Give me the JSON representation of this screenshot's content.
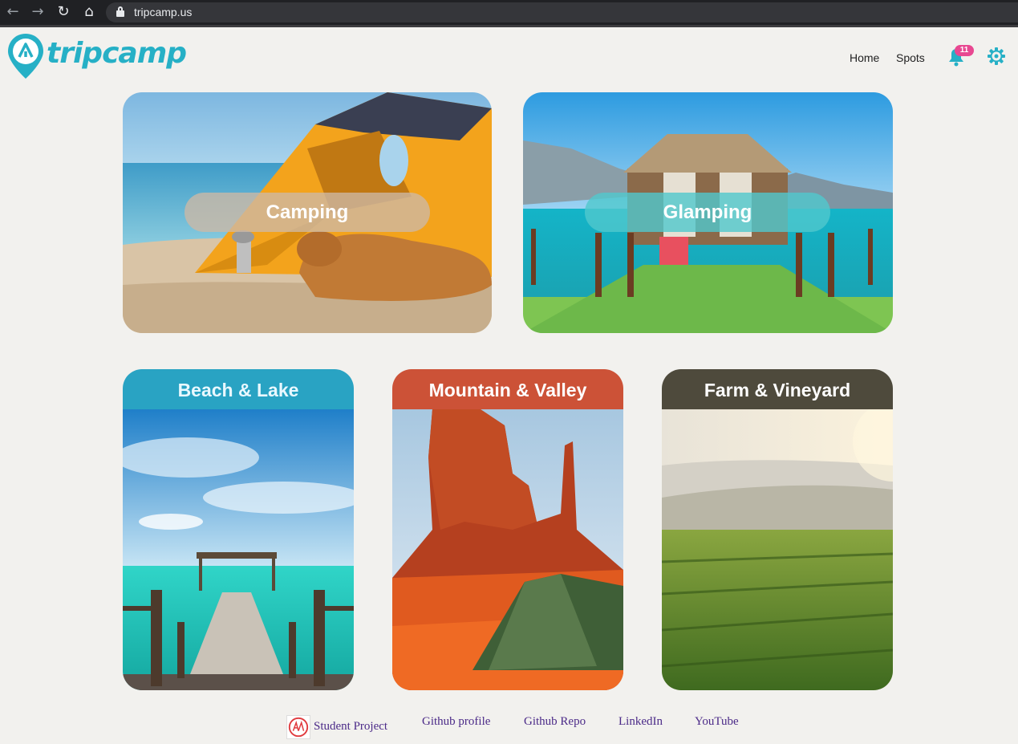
{
  "browser": {
    "url": "tripcamp.us",
    "icons": [
      "back-arrow-icon",
      "forward-arrow-icon",
      "reload-icon",
      "home-icon",
      "lock-icon"
    ]
  },
  "header": {
    "logo_text": "tripcamp",
    "nav": {
      "home": "Home",
      "spots": "Spots"
    },
    "notification_count": "11",
    "accent_color": "#26b0c6",
    "badge_color": "#e84891"
  },
  "categories": {
    "camping": "Camping",
    "glamping": "Glamping",
    "beach": "Beach & Lake",
    "mountain": "Mountain & Valley",
    "farm": "Farm & Vineyard"
  },
  "category_colors": {
    "beach": "#29a3c3",
    "mountain": "#cc5237",
    "farm": "#4e4a3c"
  },
  "footer": {
    "student_project": "Student Project",
    "github_profile": "Github profile",
    "github_repo": "Github Repo",
    "linkedin": "LinkedIn",
    "youtube": "YouTube"
  }
}
